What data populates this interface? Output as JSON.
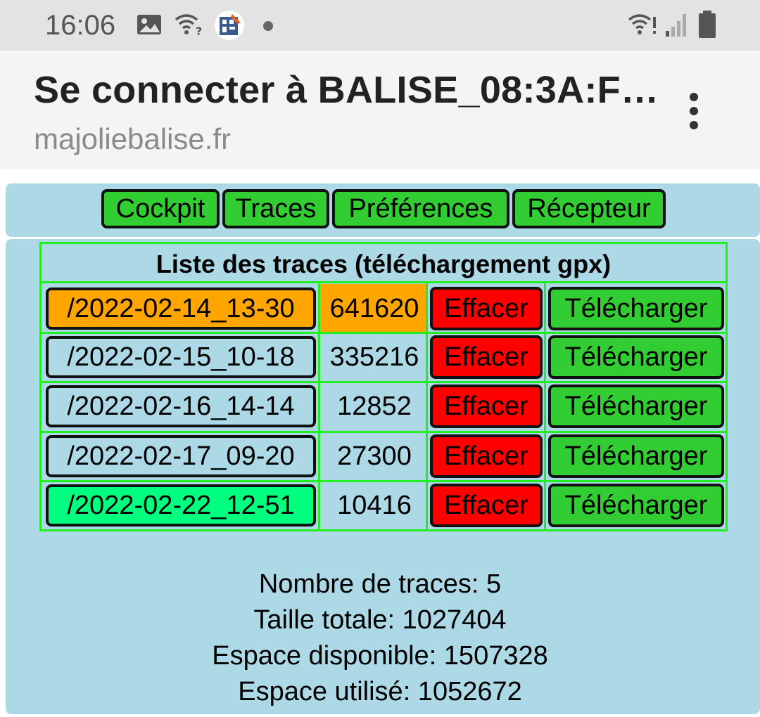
{
  "status_bar": {
    "time": "16:06",
    "icons": [
      "image-icon",
      "wifi-question-icon",
      "app-icon",
      "notification-dot-icon",
      "wifi-alert-icon",
      "signal-icon",
      "battery-icon"
    ]
  },
  "header": {
    "title": "Se connecter à BALISE_08:3A:F…",
    "url": "majoliebalise.fr",
    "menu_icon": "more-vert-icon"
  },
  "nav": {
    "items": [
      {
        "label": "Cockpit"
      },
      {
        "label": "Traces"
      },
      {
        "label": "Préférences"
      },
      {
        "label": "Récepteur"
      }
    ]
  },
  "traces": {
    "title": "Liste des traces (téléchargement gpx)",
    "delete_label": "Effacer",
    "download_label": "Télécharger",
    "rows": [
      {
        "name": "/2022-02-14_13-30",
        "size": "641620",
        "highlight": "#ffa500",
        "size_bg": "#ffa500"
      },
      {
        "name": "/2022-02-15_10-18",
        "size": "335216",
        "highlight": "#add8e6",
        "size_bg": "#add8e6"
      },
      {
        "name": "/2022-02-16_14-14",
        "size": "12852",
        "highlight": "#add8e6",
        "size_bg": "#add8e6"
      },
      {
        "name": "/2022-02-17_09-20",
        "size": "27300",
        "highlight": "#add8e6",
        "size_bg": "#add8e6"
      },
      {
        "name": "/2022-02-22_12-51",
        "size": "10416",
        "highlight": "#00ff7f",
        "size_bg": "#add8e6"
      }
    ]
  },
  "summary": {
    "count": "Nombre de traces: 5",
    "total_size": "Taille totale: 1027404",
    "available": "Espace disponible: 1507328",
    "used": "Espace utilisé: 1052672"
  },
  "colors": {
    "panel_bg": "#add8e6",
    "button_green": "#32cd32",
    "button_red": "#ff0000",
    "table_border": "#22ee22"
  }
}
